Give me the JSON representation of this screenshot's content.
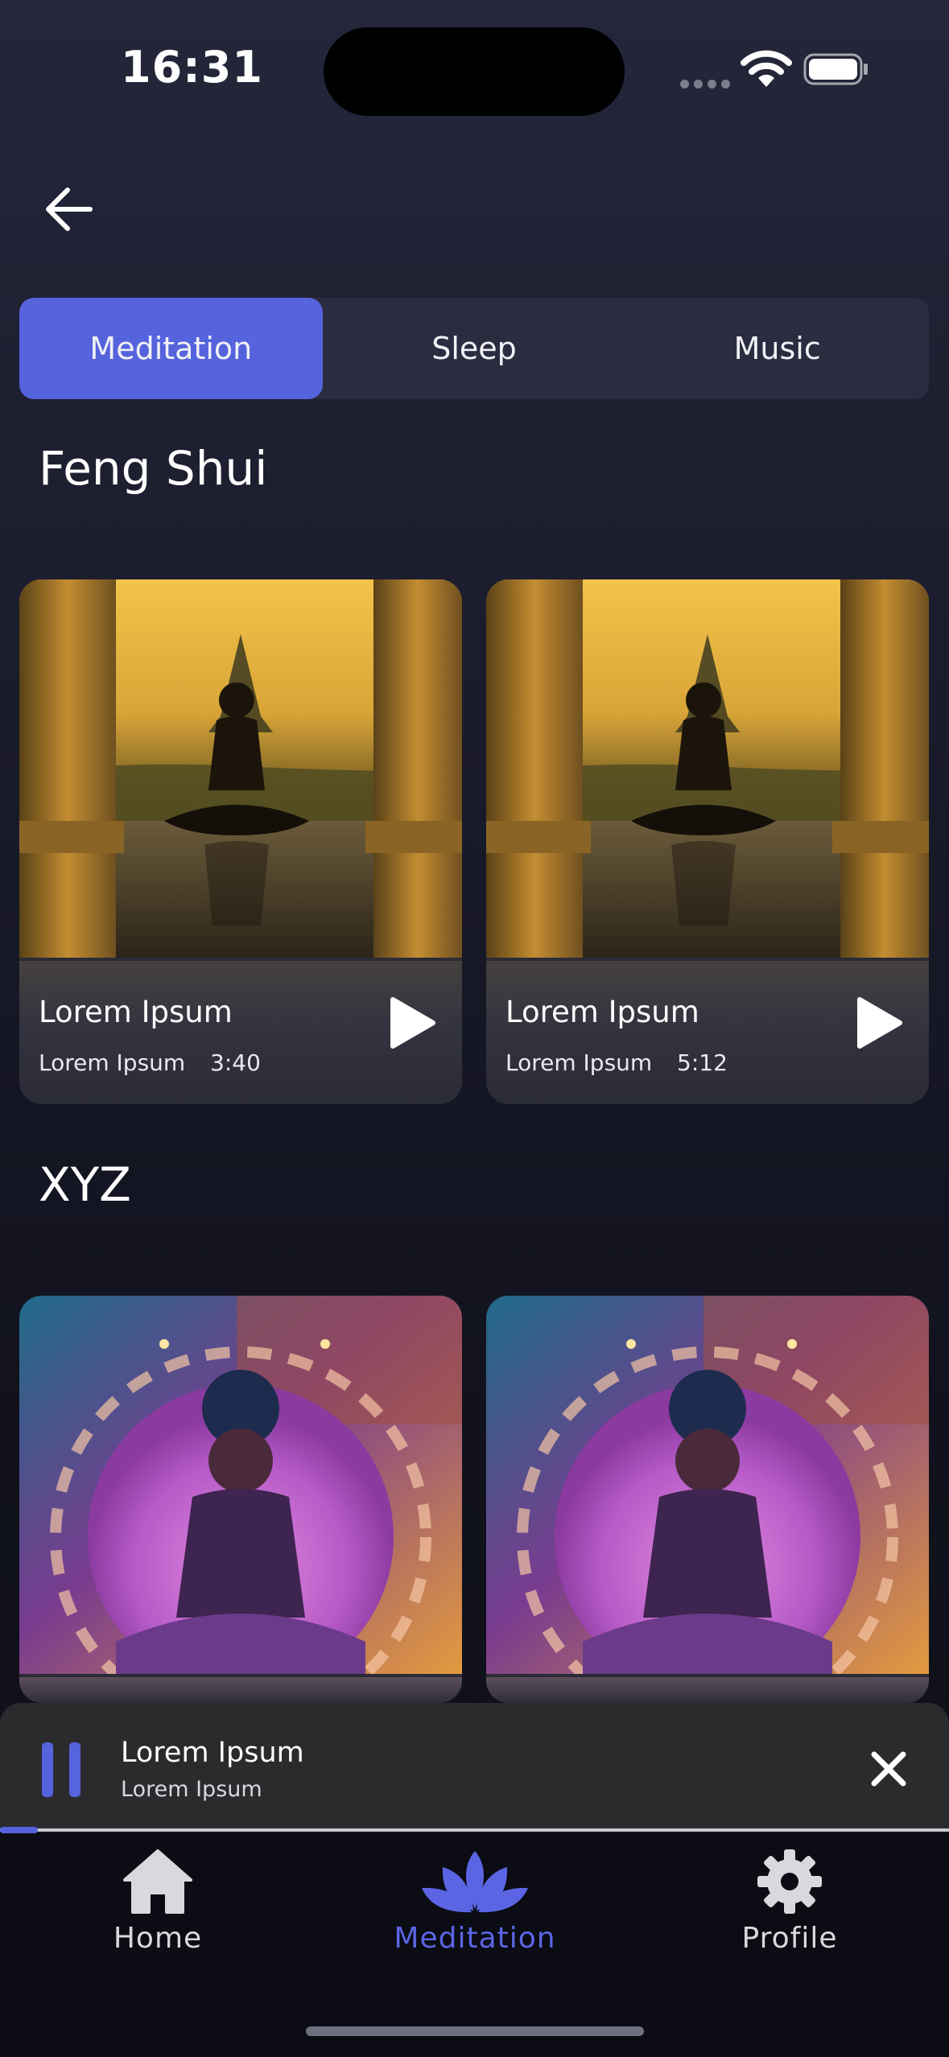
{
  "status_bar": {
    "time": "16:31"
  },
  "tabs": [
    {
      "label": "Meditation",
      "active": true
    },
    {
      "label": "Sleep",
      "active": false
    },
    {
      "label": "Music",
      "active": false
    }
  ],
  "sections": [
    {
      "title": "Feng Shui",
      "cards": [
        {
          "title": "Lorem Ipsum",
          "subtitle": "Lorem Ipsum",
          "duration": "3:40"
        },
        {
          "title": "Lorem Ipsum",
          "subtitle": "Lorem Ipsum",
          "duration": "5:12"
        }
      ]
    },
    {
      "title": "XYZ",
      "cards": [
        {},
        {}
      ]
    }
  ],
  "mini_player": {
    "title": "Lorem Ipsum",
    "subtitle": "Lorem Ipsum",
    "progress": 0.04
  },
  "nav": [
    {
      "label": "Home",
      "icon": "home-icon",
      "active": false
    },
    {
      "label": "Meditation",
      "icon": "lotus-icon",
      "active": true
    },
    {
      "label": "Profile",
      "icon": "gear-icon",
      "active": false
    }
  ],
  "colors": {
    "accent": "#5563dd",
    "tab_bg": "#2a2c40",
    "player_bg": "#2b2b2e"
  }
}
